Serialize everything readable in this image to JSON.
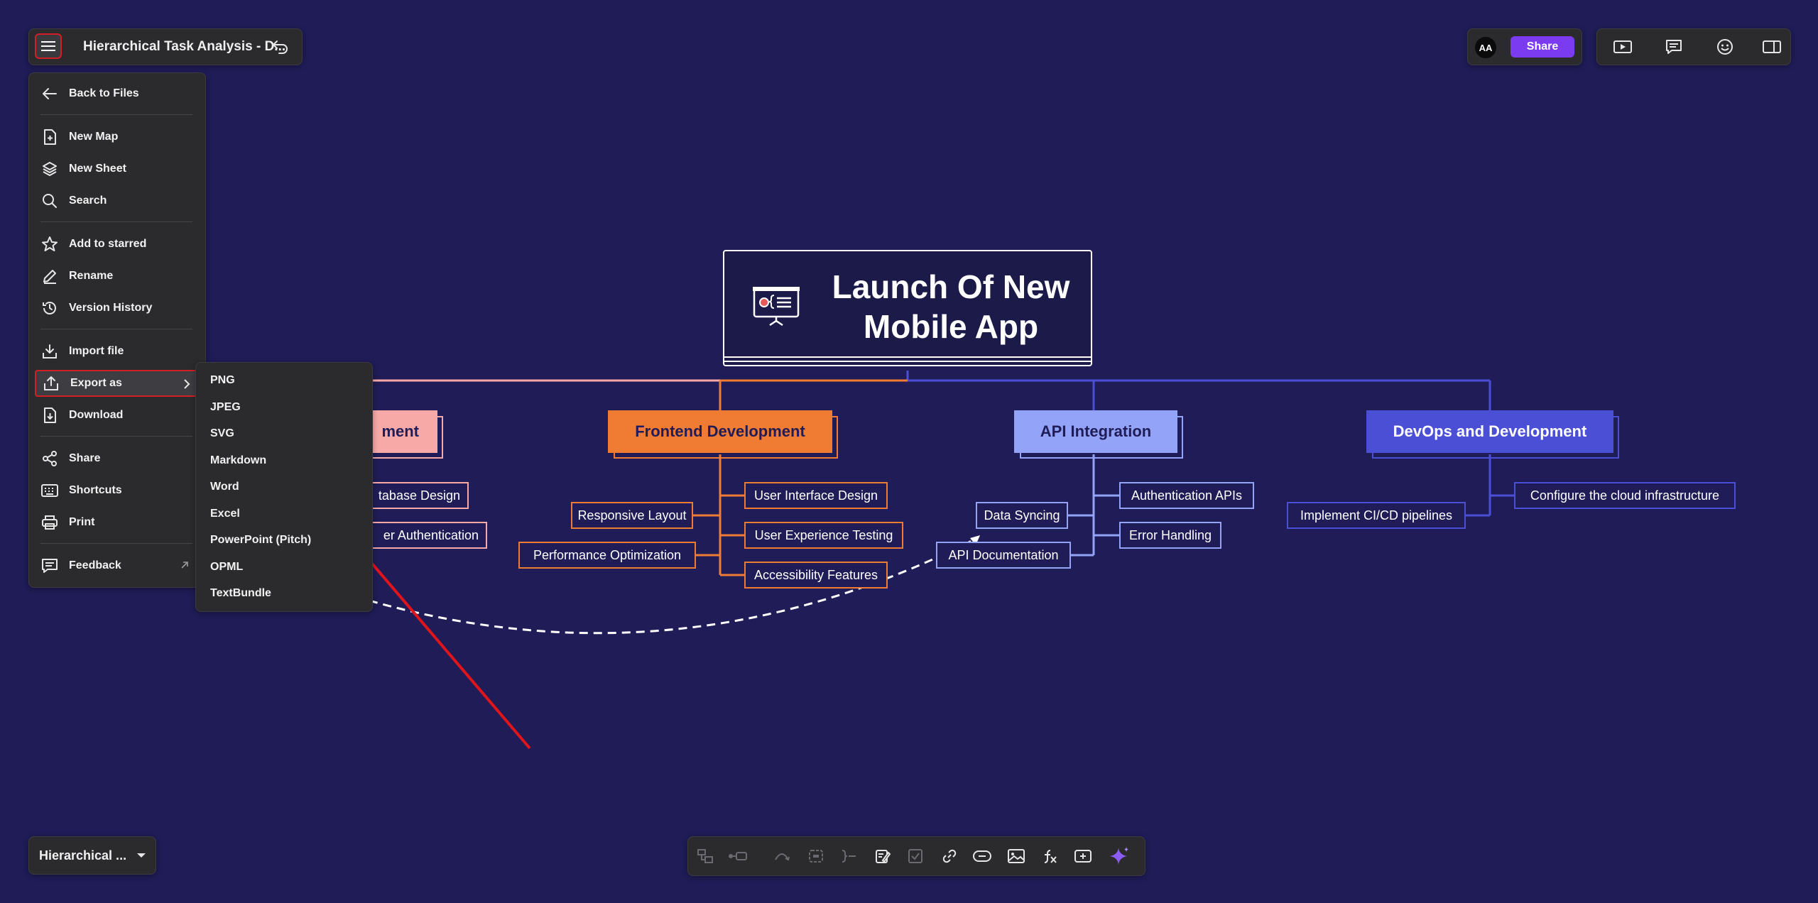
{
  "header": {
    "doc_title": "Hierarchical Task Analysis - D...",
    "avatar_initials": "AA",
    "share_label": "Share"
  },
  "main_menu": {
    "items": [
      {
        "label": "Back to Files",
        "icon": "arrow-left-icon"
      },
      {
        "label": "New Map",
        "icon": "new-file-icon"
      },
      {
        "label": "New Sheet",
        "icon": "layers-icon"
      },
      {
        "label": "Search",
        "icon": "search-icon"
      },
      {
        "label": "Add to starred",
        "icon": "star-icon"
      },
      {
        "label": "Rename",
        "icon": "pencil-icon"
      },
      {
        "label": "Version History",
        "icon": "history-icon"
      },
      {
        "label": "Import file",
        "icon": "import-icon"
      },
      {
        "label": "Export as",
        "icon": "export-icon"
      },
      {
        "label": "Download",
        "icon": "download-icon"
      },
      {
        "label": "Share",
        "icon": "share-icon"
      },
      {
        "label": "Shortcuts",
        "icon": "keyboard-icon"
      },
      {
        "label": "Print",
        "icon": "printer-icon"
      },
      {
        "label": "Feedback",
        "icon": "chat-icon"
      }
    ]
  },
  "export_submenu": {
    "items": [
      "PNG",
      "JPEG",
      "SVG",
      "Markdown",
      "Word",
      "Excel",
      "PowerPoint (Pitch)",
      "OPML",
      "TextBundle"
    ]
  },
  "bottom_left": {
    "sheet_label": "Hierarchical ..."
  },
  "mindmap": {
    "root": {
      "line1": "Launch Of New",
      "line2": "Mobile App"
    },
    "branches": [
      {
        "label": "ment",
        "color": "#f7a9a8",
        "text_color": "#1f1c57",
        "leaves": [
          "tabase Design",
          "er Authentication"
        ]
      },
      {
        "label": "Frontend Development",
        "color": "#f07b33",
        "text_color": "#1f1c57",
        "leaves": [
          "User Interface Design",
          "User Experience Testing",
          "Accessibility Features",
          "Responsive Layout",
          "Performance Optimization"
        ]
      },
      {
        "label": "API Integration",
        "color": "#93a3f7",
        "text_color": "#1f1c57",
        "leaves": [
          "Authentication APIs",
          "Error Handling",
          "Data Syncing",
          "API Documentation"
        ]
      },
      {
        "label": "DevOps and Development",
        "color": "#4b4fd6",
        "text_color": "#ffffff",
        "leaves": [
          "Configure the cloud infrastructure",
          "Implement CI/CD pipelines"
        ]
      }
    ]
  },
  "colors": {
    "background": "#1f1c57",
    "accent": "#7b3cf1",
    "highlight": "#d21f26",
    "annotation_arrow": "#e0141b"
  }
}
